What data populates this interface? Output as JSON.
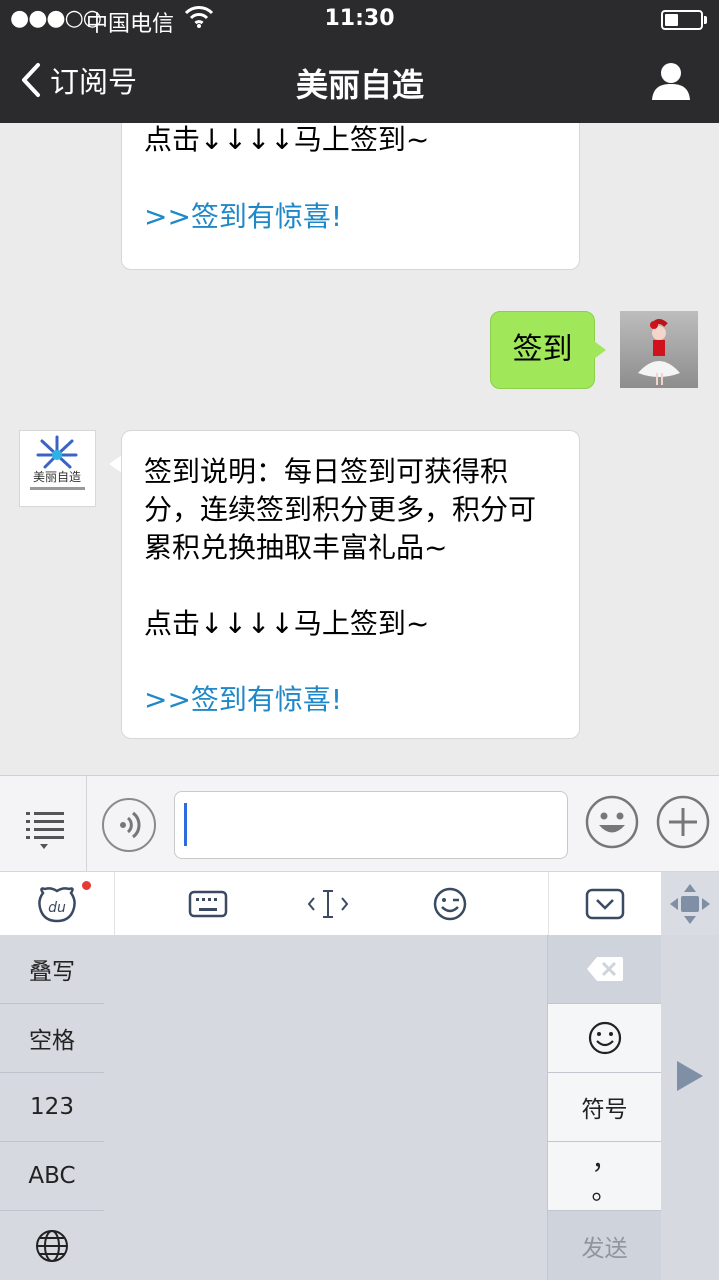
{
  "status_bar": {
    "signal": "●●●○○",
    "carrier": "中国电信",
    "time": "11:30"
  },
  "nav": {
    "back_label": "订阅号",
    "title": "美丽自造"
  },
  "messages": {
    "m1_tap": "点击↓↓↓↓马上签到~",
    "m1_link": ">>签到有惊喜!",
    "m2_text": "签到",
    "m3_desc": "签到说明：每日签到可获得积分，连续签到积分更多，积分可累积兑换抽取丰富礼品~",
    "m3_tap": "点击↓↓↓↓马上签到~",
    "m3_link": ">>签到有惊喜!",
    "brand_logo_text": "美丽自造"
  },
  "input": {
    "value": ""
  },
  "keyboard": {
    "left_keys": [
      "叠写",
      "空格",
      "123",
      "ABC"
    ],
    "symbols_label": "符号",
    "punct_top": "，",
    "punct_bottom": "。",
    "send_label": "发送"
  },
  "icons": {
    "menu": "list-icon",
    "voice": "voice-icon",
    "emoji": "smiley-icon",
    "plus": "plus-icon",
    "ime_logo": "baidu-du-icon",
    "keyboard": "keyboard-icon",
    "cursor": "text-cursor-icon",
    "wink": "wink-face-icon",
    "hide": "hide-keyboard-icon",
    "move": "move-arrows-icon",
    "delete": "backspace-icon",
    "globe": "globe-icon",
    "play": "play-icon"
  },
  "colors": {
    "nav_bg": "#2b2b2d",
    "bubble_sent": "#a0e75a",
    "link": "#1e88c8",
    "caret": "#2d6be0",
    "ime_dot": "#e53935"
  }
}
